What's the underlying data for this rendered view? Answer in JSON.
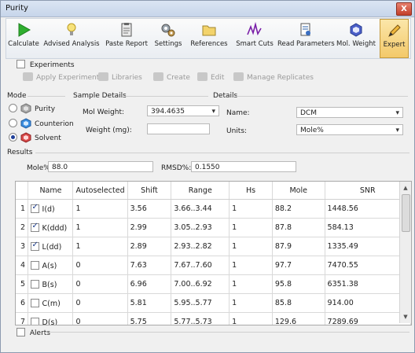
{
  "window": {
    "title": "Purity",
    "close_glyph": "X"
  },
  "ribbon": [
    {
      "label": "Calculate",
      "icon": "play-icon"
    },
    {
      "label": "Advised Analysis",
      "icon": "lightbulb-icon"
    },
    {
      "label": "Paste Report",
      "icon": "clipboard-icon"
    },
    {
      "label": "Settings",
      "icon": "gears-icon"
    },
    {
      "label": "References",
      "icon": "folder-icon"
    },
    {
      "label": "Smart Cuts",
      "icon": "scissors-icon"
    },
    {
      "label": "Read Parameters",
      "icon": "document-gear-icon"
    },
    {
      "label": "Mol. Weight",
      "icon": "hexagon-icon"
    },
    {
      "label": "Expert",
      "icon": "pencil-icon"
    }
  ],
  "experiments": {
    "label": "Experiments",
    "tools": [
      "Apply Experiment",
      "Libraries",
      "Create",
      "Edit",
      "Manage Replicates"
    ]
  },
  "mode": {
    "label": "Mode",
    "options": [
      "Purity",
      "Counterion",
      "Solvent"
    ],
    "selected": "Solvent"
  },
  "sample": {
    "label": "Sample Details",
    "mol_weight_label": "Mol Weight:",
    "mol_weight_value": "394.4635",
    "weight_label": "Weight (mg):",
    "weight_value": ""
  },
  "details": {
    "label": "Details",
    "name_label": "Name:",
    "name_value": "DCM",
    "units_label": "Units:",
    "units_value": "Mole%"
  },
  "results": {
    "label": "Results",
    "mole_label": "Mole%",
    "mole_value": "88.0",
    "rmsd_label": "RMSD%:",
    "rmsd_value": "0.1550"
  },
  "table": {
    "columns": [
      "Name",
      "Autoselected",
      "Shift",
      "Range",
      "Hs",
      "Mole",
      "SNR"
    ],
    "rows": [
      {
        "n": "1",
        "checked": true,
        "name": "I(d)",
        "auto": "1",
        "shift": "3.56",
        "range": "3.66..3.44",
        "hs": "1",
        "mole": "88.2",
        "snr": "1448.56"
      },
      {
        "n": "2",
        "checked": true,
        "name": "K(ddd)",
        "auto": "1",
        "shift": "2.99",
        "range": "3.05..2.93",
        "hs": "1",
        "mole": "87.8",
        "snr": "584.13"
      },
      {
        "n": "3",
        "checked": true,
        "name": "L(dd)",
        "auto": "1",
        "shift": "2.89",
        "range": "2.93..2.82",
        "hs": "1",
        "mole": "87.9",
        "snr": "1335.49"
      },
      {
        "n": "4",
        "checked": false,
        "name": "A(s)",
        "auto": "0",
        "shift": "7.63",
        "range": "7.67..7.60",
        "hs": "1",
        "mole": "97.7",
        "snr": "7470.55"
      },
      {
        "n": "5",
        "checked": false,
        "name": "B(s)",
        "auto": "0",
        "shift": "6.96",
        "range": "7.00..6.92",
        "hs": "1",
        "mole": "95.8",
        "snr": "6351.38"
      },
      {
        "n": "6",
        "checked": false,
        "name": "C(m)",
        "auto": "0",
        "shift": "5.81",
        "range": "5.95..5.77",
        "hs": "1",
        "mole": "85.8",
        "snr": "914.00"
      },
      {
        "n": "7",
        "checked": false,
        "name": "D(s)",
        "auto": "0",
        "shift": "5.75",
        "range": "5.77..5.73",
        "hs": "1",
        "mole": "129.6",
        "snr": "7289.69"
      }
    ]
  },
  "alerts": {
    "label": "Alerts"
  }
}
